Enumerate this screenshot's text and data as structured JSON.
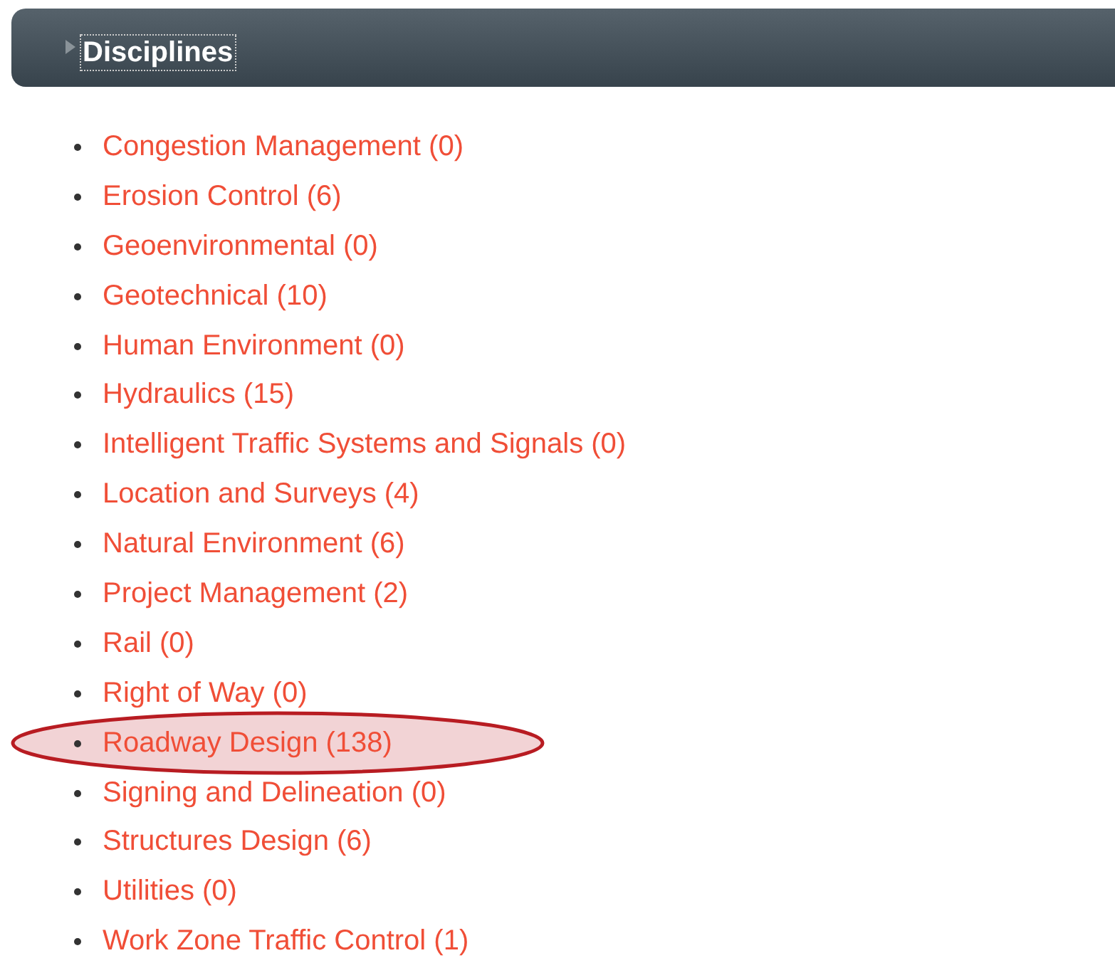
{
  "panel": {
    "title": "Disciplines",
    "expanded": false
  },
  "disciplines": [
    {
      "label": "Congestion Management (0)",
      "highlighted": false
    },
    {
      "label": "Erosion Control (6)",
      "highlighted": false
    },
    {
      "label": "Geoenvironmental (0)",
      "highlighted": false
    },
    {
      "label": "Geotechnical (10)",
      "highlighted": false
    },
    {
      "label": "Human Environment (0)",
      "highlighted": false
    },
    {
      "label": "Hydraulics (15)",
      "highlighted": false
    },
    {
      "label": "Intelligent Traffic Systems and Signals (0)",
      "highlighted": false
    },
    {
      "label": "Location and Surveys (4)",
      "highlighted": false
    },
    {
      "label": "Natural Environment (6)",
      "highlighted": false
    },
    {
      "label": "Project Management (2)",
      "highlighted": false
    },
    {
      "label": "Rail (0)",
      "highlighted": false
    },
    {
      "label": "Right of Way (0)",
      "highlighted": false
    },
    {
      "label": "Roadway Design (138)",
      "highlighted": true
    },
    {
      "label": "Signing and Delineation (0)",
      "highlighted": false
    },
    {
      "label": "Structures Design (6)",
      "highlighted": false
    },
    {
      "label": "Utilities (0)",
      "highlighted": false
    },
    {
      "label": "Work Zone Traffic Control (1)",
      "highlighted": false
    }
  ]
}
